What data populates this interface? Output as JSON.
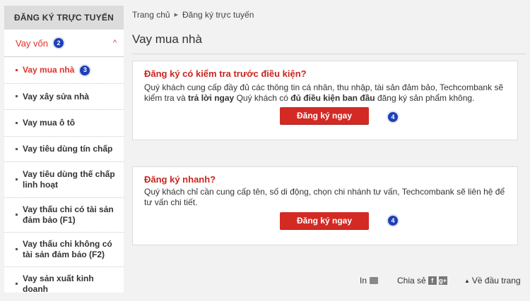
{
  "sidebar": {
    "header": "ĐĂNG KÝ TRỰC TUYẾN",
    "group": {
      "label": "Vay vốn",
      "badge": "2"
    },
    "items": [
      {
        "label": "Vay mua nhà",
        "badge": "3"
      },
      {
        "label": "Vay xây sửa nhà"
      },
      {
        "label": "Vay mua ô tô"
      },
      {
        "label": "Vay tiêu dùng tín chấp"
      },
      {
        "label": "Vay tiêu dùng thế chấp linh hoạt"
      },
      {
        "label": "Vay thấu chi có tài sản đảm bảo (F1)"
      },
      {
        "label": "Vay thấu chi không có tài sản đảm bảo (F2)"
      },
      {
        "label": "Vay sản xuất kinh doanh"
      }
    ]
  },
  "breadcrumb": {
    "home": "Trang chủ",
    "current": "Đăng ký trực tuyến"
  },
  "page_title": "Vay mua nhà",
  "cards": [
    {
      "title": "Đăng ký có kiểm tra trước điều kiện?",
      "desc_1": "Quý khách cung cấp đầy đủ các thông tin cá nhân, thu nhập, tài sản đảm bảo, Techcombank sẽ kiểm tra và ",
      "desc_2": "trả lời ngay",
      "desc_3": " Quý khách có ",
      "desc_4": "đủ điều kiện ban đầu",
      "desc_5": " đăng ký sản phẩm không.",
      "button": "Đăng ký ngay",
      "badge": "4"
    },
    {
      "title": "Đăng ký nhanh?",
      "desc_1": "Quý khách chỉ cần cung cấp tên, số di động, chọn chi nhánh tư vấn, Techcombank sẽ liên hệ để tư vấn chi tiết.",
      "button": "Đăng ký ngay",
      "badge": "4"
    }
  ],
  "footer": {
    "print": "In",
    "share": "Chia sẻ",
    "facebook": "f",
    "googleplus": "g+",
    "top": "Về đầu trang"
  },
  "colors": {
    "accent": "#e0312b",
    "button": "#d32a24",
    "badge": "#1f3fb5"
  }
}
